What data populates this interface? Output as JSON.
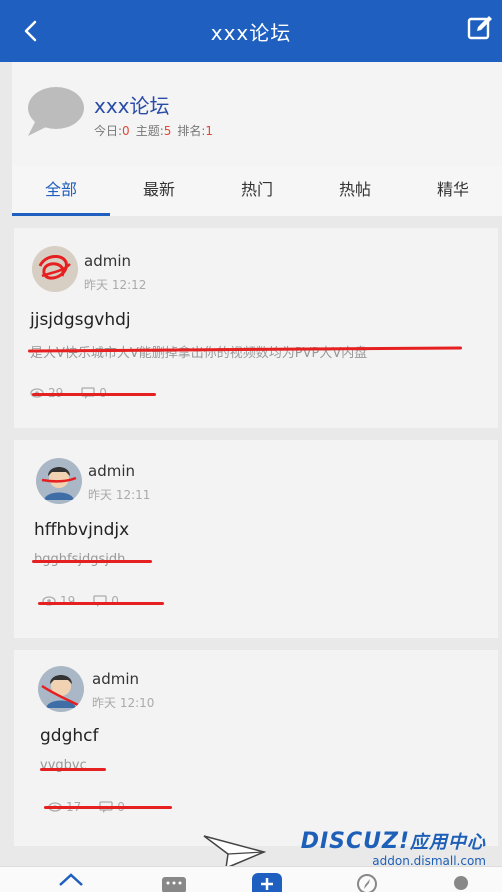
{
  "header": {
    "title": "xxx论坛"
  },
  "forum": {
    "name": "xxx论坛",
    "today_label": "今日:",
    "today_value": "0",
    "topics_label": "主题:",
    "topics_value": "5",
    "rank_label": "排名:",
    "rank_value": "1"
  },
  "tabs": [
    {
      "label": "全部"
    },
    {
      "label": "最新"
    },
    {
      "label": "热门"
    },
    {
      "label": "热帖"
    },
    {
      "label": "精华"
    }
  ],
  "posts": [
    {
      "author": "admin",
      "time": "昨天 12:12",
      "title": "jjsjdgsgvhdj",
      "excerpt": "是大V快乐城市大V能删掉拿出你的视频数均为PVP大V内盘",
      "views": "29",
      "replies": "0"
    },
    {
      "author": "admin",
      "time": "昨天 12:11",
      "title": "hffhbvjndjx",
      "excerpt": "bgghfsjdgsjdh",
      "views": "19",
      "replies": "0"
    },
    {
      "author": "admin",
      "time": "昨天 12:10",
      "title": "gdghcf",
      "excerpt": "vvgbvc",
      "views": "17",
      "replies": "0"
    }
  ],
  "watermark": {
    "brand": "DISCUZ!",
    "brand_cn": "应用中心",
    "url": "addon.dismall.com"
  },
  "colors": {
    "primary": "#1f5fbf",
    "accent_red": "#e0483a",
    "background": "#e9e9e9"
  }
}
